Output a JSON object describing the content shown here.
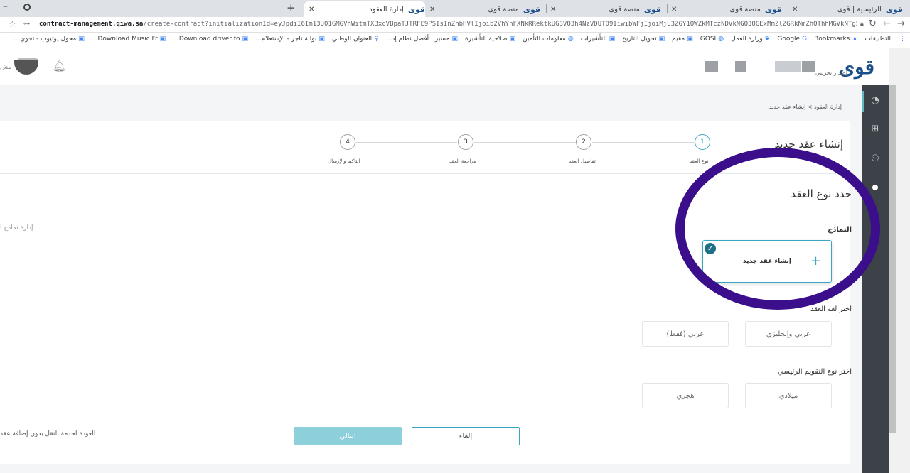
{
  "browser": {
    "tabs": [
      {
        "label": "الرئيسية | قوى",
        "logo": "قوى",
        "active": false
      },
      {
        "label": "منصة قوى",
        "logo": "قوى",
        "active": false
      },
      {
        "label": "منصة قوى",
        "logo": "قوى",
        "active": false
      },
      {
        "label": "منصة قوى",
        "logo": "قوى",
        "active": false
      },
      {
        "label": "إدارة العقود",
        "logo": "قوى",
        "active": true
      }
    ],
    "new_tab": "+",
    "url_host": "contract-management.qiwa.sa",
    "url_path": "/create-contract?initializationId=eyJpdiI6Im13U01GMGVhWitmTXBxcVBpaTJTRFE9PSIsInZhbHVlIjoib2VhYnFXNkRRektkUGSVQ3h4NzVDUT09IiwibWFjIjoiMjU3ZGY1OWZkMTczNDVkNGQ3OGExMmZlZGRkNmZhOThhMGVkNTg5O...",
    "bookmarks": [
      {
        "label": "التطبيقات",
        "icon": "apps-icon"
      },
      {
        "label": "Bookmarks",
        "icon": "star-icon"
      },
      {
        "label": "Google",
        "icon": "google-icon"
      },
      {
        "label": "وزارة العمل",
        "icon": "leaf-icon"
      },
      {
        "label": "GOSI",
        "icon": "globe-icon"
      },
      {
        "label": "مقيم",
        "icon": "site-icon"
      },
      {
        "label": "تحويل التاريخ",
        "icon": "site-icon"
      },
      {
        "label": "التأشيرات",
        "icon": "site-icon"
      },
      {
        "label": "معلومات التأمين",
        "icon": "globe-icon"
      },
      {
        "label": "صلاحية التأشيرة",
        "icon": "site-icon"
      },
      {
        "label": "مسير | أفضل نظام إد...",
        "icon": "site-icon"
      },
      {
        "label": "العنوان الوطني",
        "icon": "pin-icon"
      },
      {
        "label": "بوابة تاجر - الإستعلام...",
        "icon": "site-icon"
      },
      {
        "label": "Download driver fo...",
        "icon": "site-icon"
      },
      {
        "label": "Download Music Fr...",
        "icon": "site-icon"
      },
      {
        "label": "محول يوتيوب - تحوي...",
        "icon": "site-icon"
      }
    ]
  },
  "header": {
    "logo": "قوى",
    "env_label": "إصدار تجريبي",
    "cut_text": "مش"
  },
  "breadcrumb": "إدارة العقود > إنشاء عقد جديد",
  "page_title": "إنشاء عقد جديد",
  "steps": [
    {
      "number": "1",
      "label": "نوع العقد"
    },
    {
      "number": "2",
      "label": "تفاصيل العقد"
    },
    {
      "number": "3",
      "label": "مراجعة العقد"
    },
    {
      "number": "4",
      "label": "التأكيد والإرسال"
    }
  ],
  "section_title": "حدد نوع العقد",
  "templates_label": "النماذج",
  "manage_templates_link": "إدارة نماذج ا",
  "template_card": {
    "label": "إنشاء عقد جديد"
  },
  "language_label": "اختر لغة العقد",
  "language_options": [
    "عربي وإنجليزي",
    "عربي (فقط)"
  ],
  "calendar_label": "اختر نوع التقويم الرئيسي",
  "calendar_options": [
    "ميلادي",
    "هجري"
  ],
  "buttons": {
    "next": "التالي",
    "cancel": "إلغاء"
  },
  "back_link": "العودة لخدمة النقل بدون إضافة عقد",
  "colors": {
    "brand": "#1b4f8a",
    "accent": "#3aa6c2",
    "annotation": "#3b0f8c"
  }
}
